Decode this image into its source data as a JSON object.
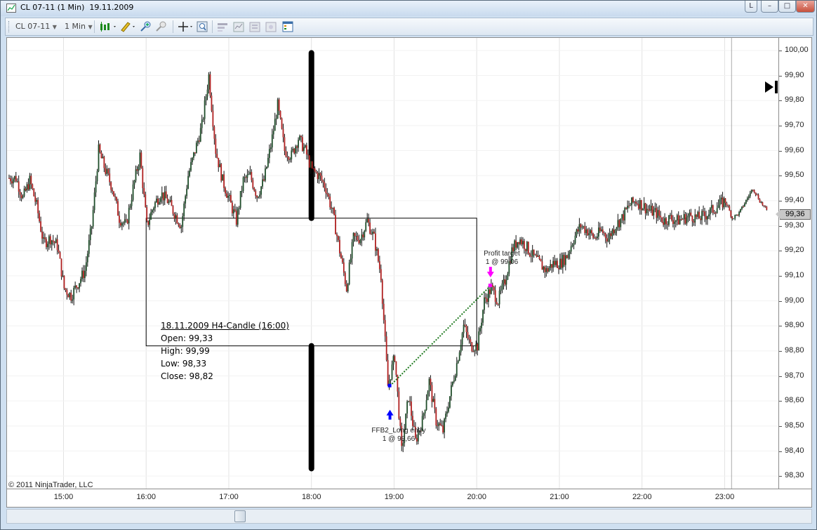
{
  "window": {
    "title": "CL 07-11 (1 Min)",
    "date": "19.11.2009",
    "buttons": [
      "L",
      "–",
      "□",
      "✕"
    ]
  },
  "toolbar": {
    "instrument": "CL 07-11",
    "interval": "1 Min",
    "icons": [
      "candlestick-style-icon",
      "pencil-draw-icon",
      "zoom-in-icon",
      "zoom-out-icon",
      "crosshair-icon",
      "magnifier-icon",
      "strategy-icon",
      "indicator-icon",
      "chart-properties-icon",
      "data-box-icon"
    ]
  },
  "info_box": {
    "header": "18.11.2009  H4-Candle (16:00)",
    "open": "Open: 99,33",
    "high": "High: 99,99",
    "low": "Low: 98,33",
    "close": "Close: 98,82"
  },
  "annotations": {
    "entry_name": "FFB2_Long entry",
    "entry_fill": "1 @ 98,66",
    "target_name": "Profit target",
    "target_fill": "1 @ 99,06"
  },
  "copyright": "© 2011 NinjaTrader, LLC",
  "current_price": "99,36",
  "chart_data": {
    "type": "candlestick",
    "x_ticks": [
      "15:00",
      "16:00",
      "17:00",
      "18:00",
      "19:00",
      "20:00",
      "21:00",
      "22:00",
      "23:00"
    ],
    "y_ticks": [
      "100,00",
      "99,90",
      "99,80",
      "99,70",
      "99,60",
      "99,50",
      "99,40",
      "99,30",
      "99,20",
      "99,10",
      "99,00",
      "98,90",
      "98,80",
      "98,70",
      "98,60",
      "98,50",
      "98,40",
      "98,30"
    ],
    "ylim": [
      98.25,
      100.05
    ],
    "xlim": [
      "14:19",
      "23:39"
    ],
    "close_path": [
      [
        "14:20",
        99.49
      ],
      [
        "14:25",
        99.49
      ],
      [
        "14:30",
        99.41
      ],
      [
        "14:35",
        99.48
      ],
      [
        "14:40",
        99.38
      ],
      [
        "14:45",
        99.23
      ],
      [
        "14:50",
        99.25
      ],
      [
        "14:55",
        99.22
      ],
      [
        "15:00",
        99.05
      ],
      [
        "15:05",
        99.02
      ],
      [
        "15:10",
        99.07
      ],
      [
        "15:15",
        99.12
      ],
      [
        "15:20",
        99.3
      ],
      [
        "15:25",
        99.6
      ],
      [
        "15:30",
        99.52
      ],
      [
        "15:35",
        99.45
      ],
      [
        "15:40",
        99.33
      ],
      [
        "15:45",
        99.3
      ],
      [
        "15:50",
        99.45
      ],
      [
        "15:55",
        99.58
      ],
      [
        "16:00",
        99.3
      ],
      [
        "16:05",
        99.38
      ],
      [
        "16:10",
        99.43
      ],
      [
        "16:15",
        99.4
      ],
      [
        "16:20",
        99.35
      ],
      [
        "16:25",
        99.3
      ],
      [
        "16:30",
        99.5
      ],
      [
        "16:35",
        99.6
      ],
      [
        "16:40",
        99.7
      ],
      [
        "16:45",
        99.9
      ],
      [
        "16:50",
        99.6
      ],
      [
        "16:55",
        99.48
      ],
      [
        "17:00",
        99.4
      ],
      [
        "17:05",
        99.32
      ],
      [
        "17:10",
        99.48
      ],
      [
        "17:15",
        99.5
      ],
      [
        "17:20",
        99.42
      ],
      [
        "17:25",
        99.48
      ],
      [
        "17:30",
        99.62
      ],
      [
        "17:35",
        99.78
      ],
      [
        "17:40",
        99.6
      ],
      [
        "17:45",
        99.58
      ],
      [
        "17:50",
        99.65
      ],
      [
        "17:55",
        99.6
      ],
      [
        "18:00",
        99.52
      ],
      [
        "18:05",
        99.5
      ],
      [
        "18:10",
        99.45
      ],
      [
        "18:15",
        99.35
      ],
      [
        "18:20",
        99.2
      ],
      [
        "18:25",
        99.05
      ],
      [
        "18:30",
        99.25
      ],
      [
        "18:35",
        99.25
      ],
      [
        "18:40",
        99.32
      ],
      [
        "18:45",
        99.25
      ],
      [
        "18:50",
        99.1
      ],
      [
        "18:55",
        98.66
      ],
      [
        "19:00",
        98.78
      ],
      [
        "19:05",
        98.4
      ],
      [
        "19:10",
        98.62
      ],
      [
        "19:15",
        98.44
      ],
      [
        "19:20",
        98.52
      ],
      [
        "19:25",
        98.68
      ],
      [
        "19:30",
        98.52
      ],
      [
        "19:35",
        98.48
      ],
      [
        "19:40",
        98.62
      ],
      [
        "19:45",
        98.75
      ],
      [
        "19:50",
        98.9
      ],
      [
        "19:55",
        98.82
      ],
      [
        "20:00",
        98.82
      ],
      [
        "20:05",
        99.0
      ],
      [
        "20:10",
        99.05
      ],
      [
        "20:15",
        99.0
      ],
      [
        "20:20",
        99.08
      ],
      [
        "20:25",
        99.2
      ],
      [
        "20:30",
        99.25
      ],
      [
        "20:35",
        99.22
      ],
      [
        "20:40",
        99.18
      ],
      [
        "20:45",
        99.15
      ],
      [
        "20:50",
        99.12
      ],
      [
        "20:55",
        99.15
      ],
      [
        "21:00",
        99.15
      ],
      [
        "21:05",
        99.18
      ],
      [
        "21:10",
        99.25
      ],
      [
        "21:15",
        99.3
      ],
      [
        "21:20",
        99.28
      ],
      [
        "21:25",
        99.25
      ],
      [
        "21:30",
        99.28
      ],
      [
        "21:35",
        99.25
      ],
      [
        "21:40",
        99.3
      ],
      [
        "21:45",
        99.33
      ],
      [
        "21:50",
        99.38
      ],
      [
        "21:55",
        99.4
      ],
      [
        "22:00",
        99.38
      ],
      [
        "22:05",
        99.36
      ],
      [
        "22:10",
        99.35
      ],
      [
        "22:15",
        99.32
      ],
      [
        "22:20",
        99.33
      ],
      [
        "22:25",
        99.32
      ],
      [
        "22:30",
        99.33
      ],
      [
        "22:35",
        99.34
      ],
      [
        "22:40",
        99.33
      ],
      [
        "22:45",
        99.34
      ],
      [
        "22:50",
        99.36
      ],
      [
        "22:55",
        99.38
      ],
      [
        "23:00",
        99.4
      ],
      [
        "23:05",
        99.33
      ],
      [
        "23:10",
        99.35
      ],
      [
        "23:15",
        99.4
      ],
      [
        "23:20",
        99.45
      ],
      [
        "23:25",
        99.4
      ],
      [
        "23:30",
        99.36
      ]
    ],
    "h4_candle": {
      "date": "18.11.2009",
      "time": "16:00",
      "open": 99.33,
      "high": 99.99,
      "low": 98.33,
      "close": 98.82
    },
    "trades": [
      {
        "name": "FFB2_Long entry",
        "time": "18:57",
        "price": 98.66,
        "side": "buy"
      },
      {
        "name": "Profit target",
        "time": "20:10",
        "price": 99.06,
        "side": "sell"
      }
    ],
    "up_color": "#1f4d2a",
    "down_color": "#b02020",
    "marker_color_entry": "#0000ff",
    "marker_color_exit": "#ff00ff",
    "grid": true
  }
}
